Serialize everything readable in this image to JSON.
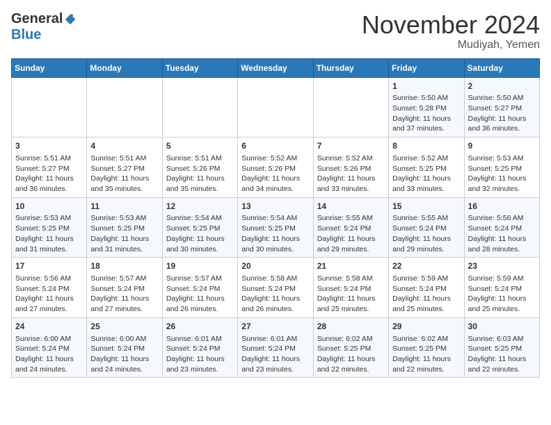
{
  "header": {
    "logo_general": "General",
    "logo_blue": "Blue",
    "month_title": "November 2024",
    "location": "Mudiyah, Yemen"
  },
  "calendar": {
    "days_of_week": [
      "Sunday",
      "Monday",
      "Tuesday",
      "Wednesday",
      "Thursday",
      "Friday",
      "Saturday"
    ],
    "weeks": [
      [
        {
          "day": "",
          "info": ""
        },
        {
          "day": "",
          "info": ""
        },
        {
          "day": "",
          "info": ""
        },
        {
          "day": "",
          "info": ""
        },
        {
          "day": "",
          "info": ""
        },
        {
          "day": "1",
          "info": "Sunrise: 5:50 AM\nSunset: 5:28 PM\nDaylight: 11 hours\nand 37 minutes."
        },
        {
          "day": "2",
          "info": "Sunrise: 5:50 AM\nSunset: 5:27 PM\nDaylight: 11 hours\nand 36 minutes."
        }
      ],
      [
        {
          "day": "3",
          "info": "Sunrise: 5:51 AM\nSunset: 5:27 PM\nDaylight: 11 hours\nand 36 minutes."
        },
        {
          "day": "4",
          "info": "Sunrise: 5:51 AM\nSunset: 5:27 PM\nDaylight: 11 hours\nand 35 minutes."
        },
        {
          "day": "5",
          "info": "Sunrise: 5:51 AM\nSunset: 5:26 PM\nDaylight: 11 hours\nand 35 minutes."
        },
        {
          "day": "6",
          "info": "Sunrise: 5:52 AM\nSunset: 5:26 PM\nDaylight: 11 hours\nand 34 minutes."
        },
        {
          "day": "7",
          "info": "Sunrise: 5:52 AM\nSunset: 5:26 PM\nDaylight: 11 hours\nand 33 minutes."
        },
        {
          "day": "8",
          "info": "Sunrise: 5:52 AM\nSunset: 5:25 PM\nDaylight: 11 hours\nand 33 minutes."
        },
        {
          "day": "9",
          "info": "Sunrise: 5:53 AM\nSunset: 5:25 PM\nDaylight: 11 hours\nand 32 minutes."
        }
      ],
      [
        {
          "day": "10",
          "info": "Sunrise: 5:53 AM\nSunset: 5:25 PM\nDaylight: 11 hours\nand 31 minutes."
        },
        {
          "day": "11",
          "info": "Sunrise: 5:53 AM\nSunset: 5:25 PM\nDaylight: 11 hours\nand 31 minutes."
        },
        {
          "day": "12",
          "info": "Sunrise: 5:54 AM\nSunset: 5:25 PM\nDaylight: 11 hours\nand 30 minutes."
        },
        {
          "day": "13",
          "info": "Sunrise: 5:54 AM\nSunset: 5:25 PM\nDaylight: 11 hours\nand 30 minutes."
        },
        {
          "day": "14",
          "info": "Sunrise: 5:55 AM\nSunset: 5:24 PM\nDaylight: 11 hours\nand 29 minutes."
        },
        {
          "day": "15",
          "info": "Sunrise: 5:55 AM\nSunset: 5:24 PM\nDaylight: 11 hours\nand 29 minutes."
        },
        {
          "day": "16",
          "info": "Sunrise: 5:56 AM\nSunset: 5:24 PM\nDaylight: 11 hours\nand 28 minutes."
        }
      ],
      [
        {
          "day": "17",
          "info": "Sunrise: 5:56 AM\nSunset: 5:24 PM\nDaylight: 11 hours\nand 27 minutes."
        },
        {
          "day": "18",
          "info": "Sunrise: 5:57 AM\nSunset: 5:24 PM\nDaylight: 11 hours\nand 27 minutes."
        },
        {
          "day": "19",
          "info": "Sunrise: 5:57 AM\nSunset: 5:24 PM\nDaylight: 11 hours\nand 26 minutes."
        },
        {
          "day": "20",
          "info": "Sunrise: 5:58 AM\nSunset: 5:24 PM\nDaylight: 11 hours\nand 26 minutes."
        },
        {
          "day": "21",
          "info": "Sunrise: 5:58 AM\nSunset: 5:24 PM\nDaylight: 11 hours\nand 25 minutes."
        },
        {
          "day": "22",
          "info": "Sunrise: 5:59 AM\nSunset: 5:24 PM\nDaylight: 11 hours\nand 25 minutes."
        },
        {
          "day": "23",
          "info": "Sunrise: 5:59 AM\nSunset: 5:24 PM\nDaylight: 11 hours\nand 25 minutes."
        }
      ],
      [
        {
          "day": "24",
          "info": "Sunrise: 6:00 AM\nSunset: 5:24 PM\nDaylight: 11 hours\nand 24 minutes."
        },
        {
          "day": "25",
          "info": "Sunrise: 6:00 AM\nSunset: 5:24 PM\nDaylight: 11 hours\nand 24 minutes."
        },
        {
          "day": "26",
          "info": "Sunrise: 6:01 AM\nSunset: 5:24 PM\nDaylight: 11 hours\nand 23 minutes."
        },
        {
          "day": "27",
          "info": "Sunrise: 6:01 AM\nSunset: 5:24 PM\nDaylight: 11 hours\nand 23 minutes."
        },
        {
          "day": "28",
          "info": "Sunrise: 6:02 AM\nSunset: 5:25 PM\nDaylight: 11 hours\nand 22 minutes."
        },
        {
          "day": "29",
          "info": "Sunrise: 6:02 AM\nSunset: 5:25 PM\nDaylight: 11 hours\nand 22 minutes."
        },
        {
          "day": "30",
          "info": "Sunrise: 6:03 AM\nSunset: 5:25 PM\nDaylight: 11 hours\nand 22 minutes."
        }
      ]
    ]
  }
}
